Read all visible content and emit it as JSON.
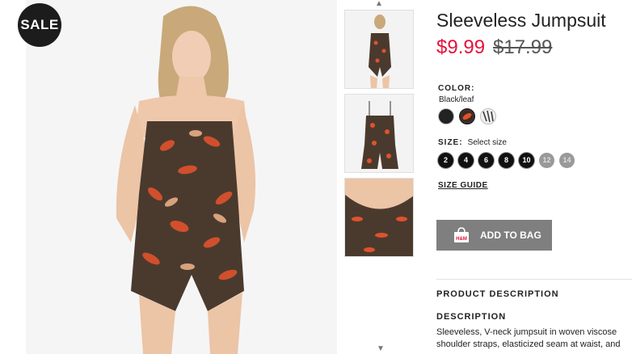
{
  "badge": {
    "sale": "SALE"
  },
  "product": {
    "title": "Sleeveless Jumpsuit",
    "sale_price": "$9.99",
    "original_price": "$17.99"
  },
  "color": {
    "label": "COLOR:",
    "selected": "Black/leaf",
    "swatches": [
      "black",
      "black-leaf",
      "white-pattern"
    ]
  },
  "size": {
    "label": "SIZE:",
    "hint": "Select size",
    "options": [
      {
        "value": "2",
        "available": true
      },
      {
        "value": "4",
        "available": true
      },
      {
        "value": "6",
        "available": true
      },
      {
        "value": "8",
        "available": true
      },
      {
        "value": "10",
        "available": true
      },
      {
        "value": "12",
        "available": false
      },
      {
        "value": "14",
        "available": false
      }
    ],
    "guide": "SIZE GUIDE"
  },
  "actions": {
    "add_to_bag": "ADD TO BAG",
    "brand_mark": "H&M"
  },
  "description": {
    "section_title": "PRODUCT DESCRIPTION",
    "heading": "DESCRIPTION",
    "line1": "Sleeveless, V-neck jumpsuit in woven viscose",
    "line2": "shoulder straps, elasticized seam at waist, and"
  },
  "icons": {
    "thumbs_up": "chevron-up-icon",
    "thumbs_down": "chevron-down-icon",
    "bag": "shopping-bag-icon"
  },
  "colors": {
    "sale_red": "#e4123a",
    "button_gray": "#7f7f7f",
    "badge_black": "#1c1c1c"
  }
}
